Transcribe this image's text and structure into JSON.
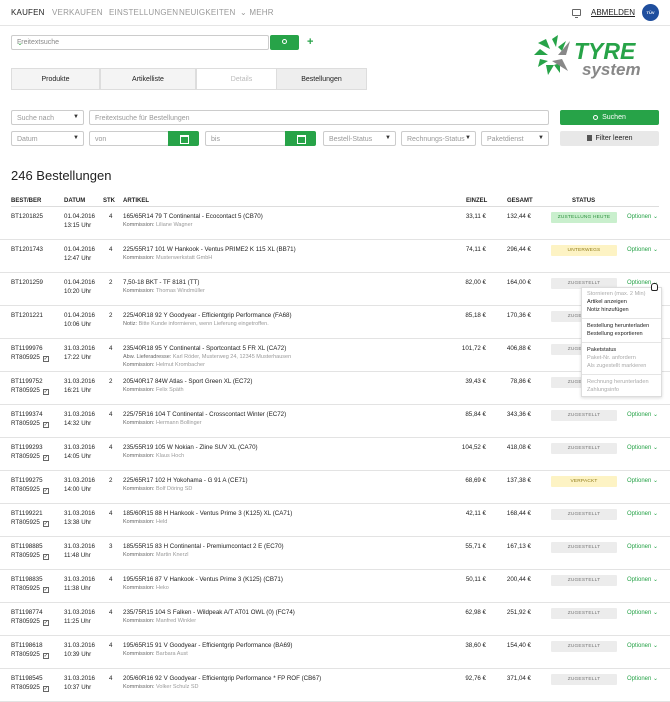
{
  "nav": {
    "items": [
      "KAUFEN",
      "VERKAUFEN",
      "EINSTELLUNGEN",
      "NEUIGKEITEN",
      "MEHR"
    ],
    "logout": "ABMELDEN",
    "tuv_label": "TÜV"
  },
  "search": {
    "placeholder": "Freitextsuche"
  },
  "logo": {
    "line1": "TYRE",
    "line2": "system"
  },
  "tabs": [
    "Produkte",
    "Artikelliste",
    "Details",
    "Bestellungen"
  ],
  "filters": {
    "search_by": "Suche nach",
    "freetext": "Freitextsuche für Bestellungen",
    "search_button": "Suchen",
    "date": "Datum",
    "from": "von",
    "to": "bis",
    "order_status": "Bestell-Status",
    "invoice_status": "Rechnungs-Status",
    "parcel_service": "Paketdienst",
    "clear_button": "Filter leeren"
  },
  "list_title": "246 Bestellungen",
  "columns": [
    "BEST/BER",
    "DATUM",
    "STK",
    "ARTIKEL",
    "EINZEL",
    "GESAMT",
    "STATUS"
  ],
  "options_label": "Optionen",
  "colors": {
    "accent": "#27a348"
  },
  "orders": [
    {
      "id": "BT1201825",
      "ref": "",
      "date": "01.04.2016",
      "time": "13:15 Uhr",
      "qty": "4",
      "article": "165/65R14 79 T Continental - Ecocontact 5 (CB70)",
      "note_label": "Kommission:",
      "note": "Liliane Wagner",
      "note2_label": "",
      "note2": "",
      "unit": "33,11 €",
      "total": "132,44 €",
      "status": "ZUSTELLUNG HEUTE",
      "kind": "green"
    },
    {
      "id": "BT1201743",
      "ref": "",
      "date": "01.04.2016",
      "time": "12:47 Uhr",
      "qty": "4",
      "article": "225/55R17 101 W Hankook - Ventus PRIME2 K 115 XL (BB71)",
      "note_label": "Kommission:",
      "note": "Musterwerkstatt GmbH",
      "note2_label": "",
      "note2": "",
      "unit": "74,11 €",
      "total": "296,44 €",
      "status": "UNTERWEGS",
      "kind": "yellow"
    },
    {
      "id": "BT1201259",
      "ref": "",
      "date": "01.04.2016",
      "time": "10:20 Uhr",
      "qty": "2",
      "article": "7,50-18 BKT - TF 8181 (TT)",
      "note_label": "Kommission:",
      "note": "Thomas Windmüller",
      "note2_label": "",
      "note2": "",
      "unit": "82,00 €",
      "total": "164,00 €",
      "status": "ZUGESTELLT",
      "kind": "grey"
    },
    {
      "id": "BT1201221",
      "ref": "",
      "date": "01.04.2016",
      "time": "10:06 Uhr",
      "qty": "2",
      "article": "225/40R18 92 Y Goodyear - Efficientgrip Performance (FA68)",
      "note_label": "Notiz:",
      "note": "Bitte Kunde informieren, wenn Lieferung eingetroffen.",
      "note2_label": "",
      "note2": "",
      "unit": "85,18 €",
      "total": "170,36 €",
      "status": "ZUGESTELLT",
      "kind": "grey"
    },
    {
      "id": "BT1199976",
      "ref": "RT805925",
      "date": "31.03.2016",
      "time": "17:22 Uhr",
      "qty": "4",
      "article": "235/40R18 95 Y Continental - Sportcontact 5 FR XL (CA72)",
      "note_label": "Abw. Lieferadresse:",
      "note": "Karl Röder, Musterweg 24, 12345 Musterhausen",
      "note2_label": "Kommission:",
      "note2": "Helmut Krombacher",
      "unit": "101,72 €",
      "total": "406,88 €",
      "status": "ZUGESTELLT",
      "kind": "grey"
    },
    {
      "id": "BT1199752",
      "ref": "RT805925",
      "date": "31.03.2016",
      "time": "16:21 Uhr",
      "qty": "2",
      "article": "205/40R17 84W Atlas - Sport Green XL (EC72)",
      "note_label": "Kommission:",
      "note": "Felix Späth",
      "note2_label": "",
      "note2": "",
      "unit": "39,43 €",
      "total": "78,86 €",
      "status": "ZUGESTELLT",
      "kind": "grey"
    },
    {
      "id": "BT1199374",
      "ref": "RT805925",
      "date": "31.03.2016",
      "time": "14:32 Uhr",
      "qty": "4",
      "article": "225/75R16 104 T Continental - Crosscontact Winter (EC72)",
      "note_label": "Kommission:",
      "note": "Hermann Bollinger",
      "note2_label": "",
      "note2": "",
      "unit": "85,84 €",
      "total": "343,36 €",
      "status": "ZUGESTELLT",
      "kind": "grey"
    },
    {
      "id": "BT1199293",
      "ref": "RT805925",
      "date": "31.03.2016",
      "time": "14:05 Uhr",
      "qty": "4",
      "article": "235/55R19 105 W Nokian - Zline SUV XL (CA70)",
      "note_label": "Kommission:",
      "note": "Klaus Hoch",
      "note2_label": "",
      "note2": "",
      "unit": "104,52 €",
      "total": "418,08 €",
      "status": "ZUGESTELLT",
      "kind": "grey"
    },
    {
      "id": "BT1199275",
      "ref": "RT805925",
      "date": "31.03.2016",
      "time": "14:00 Uhr",
      "qty": "2",
      "article": "225/65R17 102 H Yokohama - G 91 A (CE71)",
      "note_label": "Kommission:",
      "note": "Bolf Döring SD",
      "note2_label": "",
      "note2": "",
      "unit": "68,69 €",
      "total": "137,38 €",
      "status": "VERPACKT",
      "kind": "yellow"
    },
    {
      "id": "BT1199221",
      "ref": "RT805925",
      "date": "31.03.2016",
      "time": "13:38 Uhr",
      "qty": "4",
      "article": "185/60R15 88 H Hankook - Ventus Prime 3 (K125) XL (CA71)",
      "note_label": "Kommission:",
      "note": "Held",
      "note2_label": "",
      "note2": "",
      "unit": "42,11 €",
      "total": "168,44 €",
      "status": "ZUGESTELLT",
      "kind": "grey"
    },
    {
      "id": "BT1198885",
      "ref": "RT805925",
      "date": "31.03.2016",
      "time": "11:48 Uhr",
      "qty": "3",
      "article": "185/55R15 83 H Continental - Premiumcontact 2 E (EC70)",
      "note_label": "Kommission:",
      "note": "Martin Knerzl",
      "note2_label": "",
      "note2": "",
      "unit": "55,71 €",
      "total": "167,13 €",
      "status": "ZUGESTELLT",
      "kind": "grey"
    },
    {
      "id": "BT1198835",
      "ref": "RT805925",
      "date": "31.03.2016",
      "time": "11:38 Uhr",
      "qty": "4",
      "article": "195/55R16 87 V Hankook - Ventus Prime 3 (K125) (CB71)",
      "note_label": "Kommission:",
      "note": "Heko",
      "note2_label": "",
      "note2": "",
      "unit": "50,11 €",
      "total": "200,44 €",
      "status": "ZUGESTELLT",
      "kind": "grey"
    },
    {
      "id": "BT1198774",
      "ref": "RT805925",
      "date": "31.03.2016",
      "time": "11:25 Uhr",
      "qty": "4",
      "article": "235/75R15 104 S Falken - Wildpeak A/T AT01 OWL (0) (FC74)",
      "note_label": "Kommission:",
      "note": "Manfred Winkler",
      "note2_label": "",
      "note2": "",
      "unit": "62,98 €",
      "total": "251,92 €",
      "status": "ZUGESTELLT",
      "kind": "grey"
    },
    {
      "id": "BT1198618",
      "ref": "RT805925",
      "date": "31.03.2016",
      "time": "10:39 Uhr",
      "qty": "4",
      "article": "195/65R15 91 V Goodyear - Efficientgrip Performance (BA69)",
      "note_label": "Kommission:",
      "note": "Barbara Aust",
      "note2_label": "",
      "note2": "",
      "unit": "38,60 €",
      "total": "154,40 €",
      "status": "ZUGESTELLT",
      "kind": "grey"
    },
    {
      "id": "BT1198545",
      "ref": "RT805925",
      "date": "31.03.2016",
      "time": "10:37 Uhr",
      "qty": "4",
      "article": "205/60R16 92 V Goodyear - Efficientgrip Performance * FP ROF (CB67)",
      "note_label": "Kommission:",
      "note": "Volker Schulz SD",
      "note2_label": "",
      "note2": "",
      "unit": "92,76 €",
      "total": "371,04 €",
      "status": "ZUGESTELLT",
      "kind": "grey"
    }
  ],
  "menu": {
    "items": [
      {
        "label": "Stornieren (max. 2 Min)",
        "enabled": false
      },
      {
        "label": "Artikel anzeigen",
        "enabled": true
      },
      {
        "label": "Notiz hinzufügen",
        "enabled": true
      },
      {
        "label": "Bestellung herunterladen",
        "enabled": true
      },
      {
        "label": "Bestellung exportieren",
        "enabled": true
      },
      {
        "label": "Paketstatus",
        "enabled": true
      },
      {
        "label": "Paket-Nr. anfordern",
        "enabled": false
      },
      {
        "label": "Als zugestellt markieren",
        "enabled": false
      },
      {
        "label": "Rechnung herunterladen",
        "enabled": false
      },
      {
        "label": "Zahlungsinfo",
        "enabled": false
      }
    ]
  }
}
